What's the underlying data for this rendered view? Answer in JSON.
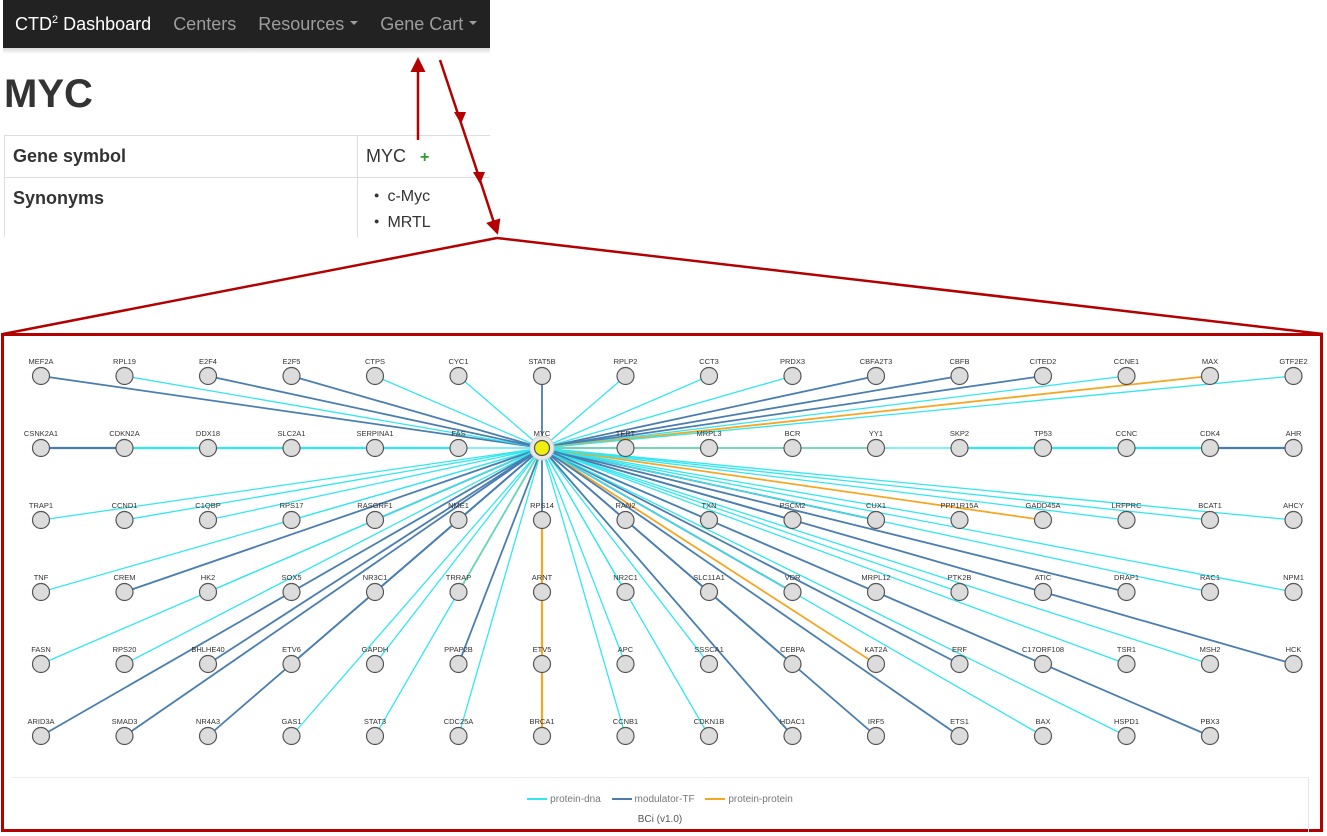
{
  "navbar": {
    "brand_main": "CTD",
    "brand_sup": "2",
    "brand_rest": " Dashboard",
    "items": [
      {
        "label": "Centers"
      },
      {
        "label": "Resources"
      },
      {
        "label": "Gene Cart"
      }
    ]
  },
  "gene": {
    "heading": "MYC",
    "symbol_label": "Gene symbol",
    "symbol_value": "MYC",
    "add_glyph": "+",
    "synonyms_label": "Synonyms",
    "synonyms": [
      "c-Myc",
      "MRTL"
    ]
  },
  "colors": {
    "annotation": "#b30000",
    "protein_dna": "#33e6f0",
    "modulator_tf": "#4a7eb0",
    "protein_protein": "#f5a623",
    "center_node": "#f0ee0e",
    "node_fill": "#dcdcdc"
  },
  "network": {
    "center": "MYC",
    "rows": [
      [
        "MEF2A",
        "RPL19",
        "E2F4",
        "E2F5",
        "CTPS",
        "CYC1",
        "STAT5B",
        "RPLP2",
        "CCT3",
        "PRDX3",
        "CBFA2T3",
        "CBFB",
        "CITED2",
        "CCNE1",
        "MAX",
        "GTF2E2"
      ],
      [
        "CSNK2A1",
        "CDKN2A",
        "DDX18",
        "SLC2A1",
        "SERPINA1",
        "FAS",
        "MYC",
        "TERT",
        "MRPL3",
        "BCR",
        "YY1",
        "SKP2",
        "TP53",
        "CCNC",
        "CDK4",
        "AHR"
      ],
      [
        "TRAP1",
        "CCND1",
        "C1QBP",
        "RPS17",
        "RASGRF1",
        "NME1",
        "RPS14",
        "RAN2",
        "TXN",
        "PSCM2",
        "CUX1",
        "PPP1R15A",
        "GADD45A",
        "LRFPRC",
        "BCAT1",
        "AHCY"
      ],
      [
        "TNF",
        "CREM",
        "HK2",
        "SOX5",
        "NR3C1",
        "TRRAP",
        "ARNT",
        "NR2C1",
        "SLC11A1",
        "VDR",
        "MRPL12",
        "PTK2B",
        "ATIC",
        "DRAP1",
        "RAC1",
        "NPM1"
      ],
      [
        "FASN",
        "RPS20",
        "BHLHE40",
        "ETV6",
        "GAPDH",
        "PPAP2B",
        "ETV5",
        "APC",
        "SSSCA1",
        "CEBPA",
        "KAT2A",
        "ERF",
        "C17ORF108",
        "TSR1",
        "MSH2",
        "HCK"
      ],
      [
        "ARID3A",
        "SMAD3",
        "NR4A3",
        "GAS1",
        "STAT3",
        "CDC25A",
        "BRCA1",
        "CCNB1",
        "CDKN1B",
        "HDAC1",
        "IRF5",
        "ETS1",
        "BAX",
        "HSPD1",
        "PBX3",
        ""
      ]
    ],
    "edges": [
      {
        "to": "MEF2A",
        "type": "modulator-TF"
      },
      {
        "to": "RPL19",
        "type": "protein-dna"
      },
      {
        "to": "E2F4",
        "type": "modulator-TF"
      },
      {
        "to": "E2F5",
        "type": "modulator-TF"
      },
      {
        "to": "CTPS",
        "type": "protein-dna"
      },
      {
        "to": "CYC1",
        "type": "protein-dna"
      },
      {
        "to": "STAT5B",
        "type": "modulator-TF"
      },
      {
        "to": "RPLP2",
        "type": "protein-dna"
      },
      {
        "to": "CCT3",
        "type": "protein-dna"
      },
      {
        "to": "PRDX3",
        "type": "protein-dna"
      },
      {
        "to": "CBFA2T3",
        "type": "modulator-TF"
      },
      {
        "to": "CBFB",
        "type": "modulator-TF"
      },
      {
        "to": "CITED2",
        "type": "modulator-TF"
      },
      {
        "to": "CCNE1",
        "type": "protein-dna"
      },
      {
        "to": "MAX",
        "type": "protein-protein"
      },
      {
        "to": "GTF2E2",
        "type": "protein-dna"
      },
      {
        "to": "FAS",
        "type": "protein-dna"
      },
      {
        "to": "TERT",
        "type": "protein-dna"
      },
      {
        "to": "MRPL3",
        "type": "protein-dna"
      },
      {
        "to": "BCR",
        "type": "protein-dna"
      },
      {
        "to": "YY1",
        "type": "protein-protein"
      },
      {
        "to": "SKP2",
        "type": "protein-dna"
      },
      {
        "to": "TRAP1",
        "type": "protein-dna"
      },
      {
        "to": "CCND1",
        "type": "protein-dna"
      },
      {
        "to": "C1QBP",
        "type": "protein-dna"
      },
      {
        "to": "RPS17",
        "type": "protein-dna"
      },
      {
        "to": "RASGRF1",
        "type": "modulator-TF"
      },
      {
        "to": "NME1",
        "type": "protein-dna"
      },
      {
        "to": "RPS14",
        "type": "modulator-TF"
      },
      {
        "to": "RAN2",
        "type": "protein-dna"
      },
      {
        "to": "TXN",
        "type": "protein-dna"
      },
      {
        "to": "PSCM2",
        "type": "modulator-TF"
      },
      {
        "to": "CUX1",
        "type": "modulator-TF"
      },
      {
        "to": "PPP1R15A",
        "type": "protein-dna"
      },
      {
        "to": "GADD45A",
        "type": "protein-protein"
      },
      {
        "to": "LRFPRC",
        "type": "protein-dna"
      },
      {
        "to": "BCAT1",
        "type": "protein-dna"
      },
      {
        "to": "AHCY",
        "type": "protein-dna"
      },
      {
        "to": "TNF",
        "type": "protein-dna"
      },
      {
        "to": "CREM",
        "type": "modulator-TF"
      },
      {
        "to": "HK2",
        "type": "protein-dna"
      },
      {
        "to": "SOX5",
        "type": "protein-dna"
      },
      {
        "to": "NR3C1",
        "type": "modulator-TF"
      },
      {
        "to": "TRRAP",
        "type": "protein-protein"
      },
      {
        "to": "NR2C1",
        "type": "protein-dna"
      },
      {
        "to": "SLC11A1",
        "type": "protein-dna"
      },
      {
        "to": "VDR",
        "type": "modulator-TF"
      },
      {
        "to": "MRPL12",
        "type": "protein-dna"
      },
      {
        "to": "PTK2B",
        "type": "protein-dna"
      },
      {
        "to": "ATIC",
        "type": "protein-dna"
      },
      {
        "to": "DRAP1",
        "type": "modulator-TF"
      },
      {
        "to": "RAC1",
        "type": "protein-dna"
      },
      {
        "to": "NPM1",
        "type": "protein-dna"
      },
      {
        "to": "FASN",
        "type": "protein-dna"
      },
      {
        "to": "RPS20",
        "type": "protein-dna"
      },
      {
        "to": "BHLHE40",
        "type": "modulator-TF"
      },
      {
        "to": "ETV6",
        "type": "modulator-TF"
      },
      {
        "to": "GAPDH",
        "type": "protein-dna"
      },
      {
        "to": "PPAP2B",
        "type": "modulator-TF"
      },
      {
        "to": "APC",
        "type": "protein-dna"
      },
      {
        "to": "SSSCA1",
        "type": "protein-dna"
      },
      {
        "to": "CEBPA",
        "type": "modulator-TF"
      },
      {
        "to": "KAT2A",
        "type": "protein-protein"
      },
      {
        "to": "ERF",
        "type": "modulator-TF"
      },
      {
        "to": "C17ORF108",
        "type": "protein-dna"
      },
      {
        "to": "TSR1",
        "type": "protein-dna"
      },
      {
        "to": "MSH2",
        "type": "protein-dna"
      },
      {
        "to": "HCK",
        "type": "modulator-TF"
      },
      {
        "to": "ARID3A",
        "type": "modulator-TF"
      },
      {
        "to": "SMAD3",
        "type": "modulator-TF"
      },
      {
        "to": "NR4A3",
        "type": "modulator-TF"
      },
      {
        "to": "GAS1",
        "type": "protein-dna"
      },
      {
        "to": "STAT3",
        "type": "protein-dna"
      },
      {
        "to": "CDC25A",
        "type": "protein-dna"
      },
      {
        "to": "CCNB1",
        "type": "protein-dna"
      },
      {
        "to": "CDKN1B",
        "type": "protein-dna"
      },
      {
        "to": "HDAC1",
        "type": "modulator-TF"
      },
      {
        "to": "IRF5",
        "type": "modulator-TF"
      },
      {
        "to": "ETS1",
        "type": "modulator-TF"
      },
      {
        "to": "BAX",
        "type": "protein-dna"
      },
      {
        "to": "HSPD1",
        "type": "protein-dna"
      },
      {
        "to": "PBX3",
        "type": "modulator-TF"
      }
    ],
    "side_edges": [
      {
        "from": "CSNK2A1",
        "to": "CDKN2A",
        "type": "modulator-TF"
      },
      {
        "from": "CDKN2A",
        "to": "DDX18",
        "type": "protein-dna"
      },
      {
        "from": "DDX18",
        "to": "SLC2A1",
        "type": "protein-dna"
      },
      {
        "from": "SLC2A1",
        "to": "SERPINA1",
        "type": "protein-dna"
      },
      {
        "from": "SERPINA1",
        "to": "FAS",
        "type": "protein-dna"
      },
      {
        "from": "SKP2",
        "to": "TP53",
        "type": "protein-dna"
      },
      {
        "from": "TP53",
        "to": "CCNC",
        "type": "protein-dna"
      },
      {
        "from": "CCNC",
        "to": "CDK4",
        "type": "protein-dna"
      },
      {
        "from": "CDK4",
        "to": "AHR",
        "type": "modulator-TF"
      },
      {
        "from": "RPS14",
        "to": "BRCA1",
        "type": "protein-protein"
      }
    ]
  },
  "legend": {
    "items": [
      {
        "label": "protein-dna",
        "type": "protein-dna"
      },
      {
        "label": "modulator-TF",
        "type": "modulator-TF"
      },
      {
        "label": "protein-protein",
        "type": "protein-protein"
      }
    ],
    "caption": "BCi (v1.0)"
  }
}
